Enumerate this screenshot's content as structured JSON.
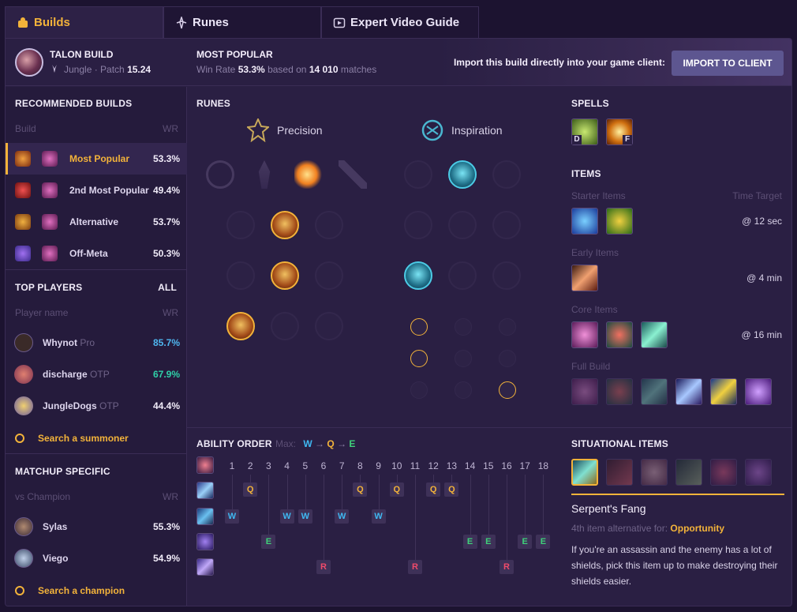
{
  "tabs": [
    {
      "label": "Builds",
      "active": true
    },
    {
      "label": "Runes",
      "active": false
    },
    {
      "label": "Expert Video Guide",
      "active": false
    }
  ],
  "header": {
    "champion_build": "TALON BUILD",
    "role": "Jungle",
    "patch_label": "Patch",
    "patch": "15.24",
    "most_popular": "MOST POPULAR",
    "winrate_label": "Win Rate",
    "winrate": "53.3%",
    "based_on": "based on",
    "matches": "14 010",
    "matches_label": "matches",
    "import_text": "Import this build directly into your game client:",
    "import_button": "IMPORT TO CLIENT"
  },
  "recommended": {
    "title": "RECOMMENDED BUILDS",
    "col_build": "Build",
    "col_wr": "WR",
    "items": [
      {
        "name": "Most Popular",
        "wr": "53.3%"
      },
      {
        "name": "2nd Most Popular",
        "wr": "49.4%"
      },
      {
        "name": "Alternative",
        "wr": "53.7%"
      },
      {
        "name": "Off-Meta",
        "wr": "50.3%"
      }
    ]
  },
  "top_players": {
    "title": "TOP PLAYERS",
    "all": "ALL",
    "col_name": "Player name",
    "col_wr": "WR",
    "players": [
      {
        "name": "Whynot",
        "tag": "Pro",
        "wr": "85.7%",
        "wr_color": "#4fb7f0"
      },
      {
        "name": "discharge",
        "tag": "OTP",
        "wr": "67.9%",
        "wr_color": "#2fd0a8"
      },
      {
        "name": "JungleDogs",
        "tag": "OTP",
        "wr": "44.4%",
        "wr_color": "#f1ecf9"
      }
    ],
    "search": "Search a summoner"
  },
  "matchup": {
    "title": "MATCHUP SPECIFIC",
    "col_vs": "vs Champion",
    "col_wr": "WR",
    "champions": [
      {
        "name": "Sylas",
        "wr": "55.3%"
      },
      {
        "name": "Viego",
        "wr": "54.9%"
      }
    ],
    "search": "Search a champion"
  },
  "runes": {
    "title": "RUNES",
    "primary": "Precision",
    "secondary": "Inspiration"
  },
  "spells": {
    "title": "SPELLS",
    "keys": [
      "D",
      "F"
    ]
  },
  "items": {
    "title": "ITEMS",
    "starter": "Starter Items",
    "time_target": "Time Target",
    "starter_time": "@ 12 sec",
    "early": "Early Items",
    "early_time": "@ 4 min",
    "core": "Core Items",
    "core_time": "@ 16 min",
    "full": "Full Build"
  },
  "ability": {
    "title": "ABILITY ORDER",
    "max_label": "Max:",
    "max": [
      "W",
      "Q",
      "E"
    ],
    "levels": [
      "1",
      "2",
      "3",
      "4",
      "5",
      "6",
      "7",
      "8",
      "9",
      "10",
      "11",
      "12",
      "13",
      "14",
      "15",
      "16",
      "17",
      "18"
    ],
    "order": [
      "W",
      "Q",
      "E",
      "W",
      "W",
      "R",
      "W",
      "Q",
      "W",
      "Q",
      "R",
      "Q",
      "Q",
      "E",
      "E",
      "R",
      "E",
      "E"
    ]
  },
  "situational": {
    "title": "SITUATIONAL ITEMS",
    "item_name": "Serpent's Fang",
    "alt_text": "4th item alternative for:",
    "alt_for": "Opportunity",
    "desc": "If you're an assassin and the enemy has a lot of shields, pick this item up to make destroying their shields easier."
  },
  "colors": {
    "accent": "#f3b33a",
    "button": "#5d5690",
    "q": "#f3b33a",
    "w": "#3fb8f2",
    "e": "#3fd07a",
    "r": "#ef4b6b"
  }
}
